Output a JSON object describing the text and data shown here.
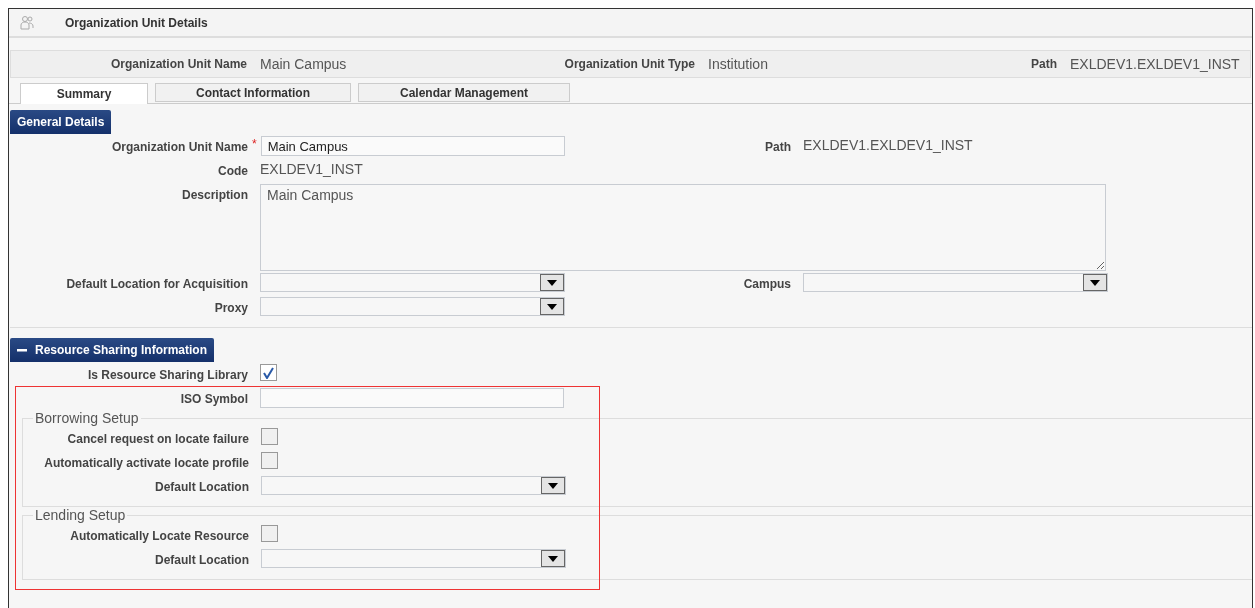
{
  "window": {
    "title": "Organization Unit Details"
  },
  "summary": [
    {
      "label": "Organization Unit Name",
      "value": "Main Campus"
    },
    {
      "label": "Organization Unit Type",
      "value": "Institution"
    },
    {
      "label": "Path",
      "value": "EXLDEV1.EXLDEV1_INST"
    }
  ],
  "tabs": [
    {
      "label": "Summary",
      "selected": true
    },
    {
      "label": "Contact Information",
      "selected": false
    },
    {
      "label": "Calendar Management",
      "selected": false
    }
  ],
  "sections": [
    {
      "title": "General Details",
      "rows": [
        {
          "cells": [
            {
              "kind": "input",
              "label": "Organization Unit Name",
              "required_mark": "*",
              "value": "Main Campus"
            },
            {
              "kind": "text",
              "label": "Path",
              "value": "EXLDEV1.EXLDEV1_INST"
            }
          ]
        },
        {
          "cells": [
            {
              "kind": "text",
              "label": "Code",
              "value": "EXLDEV1_INST"
            }
          ]
        },
        {
          "cells": [
            {
              "kind": "textarea",
              "label": "Description",
              "value": "Main Campus"
            }
          ]
        },
        {
          "cells": [
            {
              "kind": "select",
              "label": "Default Location for Acquisition"
            },
            {
              "kind": "select",
              "label": "Campus"
            }
          ]
        },
        {
          "cells": [
            {
              "kind": "select",
              "label": "Proxy"
            }
          ]
        }
      ]
    },
    {
      "title": "Resource Sharing Information",
      "expanded": true,
      "rows": [
        {
          "cells": [
            {
              "kind": "checkbox",
              "label": "Is Resource Sharing Library",
              "checked": true
            }
          ]
        }
      ],
      "highlighted": {
        "rows": [
          {
            "cells": [
              {
                "kind": "input",
                "label": "ISO Symbol"
              }
            ]
          }
        ],
        "groups": [
          {
            "legend": "Borrowing Setup",
            "rows": [
              {
                "cells": [
                  {
                    "kind": "checkbox",
                    "label": "Cancel request on locate failure",
                    "checked": false
                  }
                ]
              },
              {
                "cells": [
                  {
                    "kind": "checkbox",
                    "label": "Automatically activate locate profile",
                    "checked": false
                  }
                ]
              },
              {
                "cells": [
                  {
                    "kind": "select",
                    "label": "Default Location"
                  }
                ]
              }
            ]
          },
          {
            "legend": "Lending Setup",
            "rows": [
              {
                "cells": [
                  {
                    "kind": "checkbox",
                    "label": "Automatically Locate Resource",
                    "checked": false
                  }
                ]
              },
              {
                "cells": [
                  {
                    "kind": "select",
                    "label": "Default Location"
                  }
                ]
              }
            ]
          }
        ]
      }
    }
  ]
}
